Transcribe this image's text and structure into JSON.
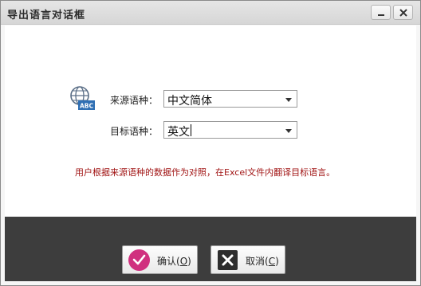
{
  "window": {
    "title": "导出语言对话框"
  },
  "form": {
    "source_label": "来源语种：",
    "source_value": "中文简体",
    "target_label": "目标语种：",
    "target_value": "英文"
  },
  "icon": {
    "name": "globe-abc-icon",
    "badge_text": "ABC"
  },
  "hint": "用户根据来源语种的数据作为对照，在Excel文件内翻译目标语言。",
  "buttons": {
    "ok_label": "确认(",
    "ok_key": "O",
    "ok_suffix": ")",
    "cancel_label": "取消(",
    "cancel_key": "C",
    "cancel_suffix": ")"
  },
  "colors": {
    "hint": "#a11414",
    "footer": "#3d3d3d",
    "ok_icon": "#d0307f"
  }
}
